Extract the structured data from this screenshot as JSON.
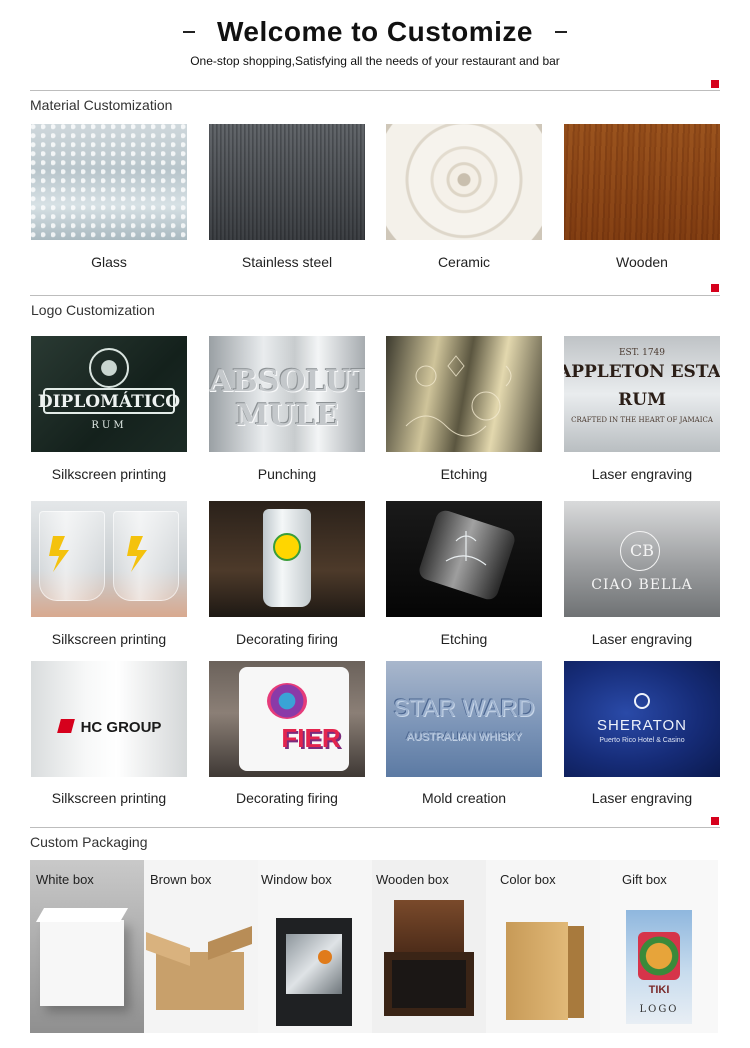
{
  "header": {
    "title": "Welcome to Customize",
    "subtitle": "One-stop shopping,Satisfying all the needs of your restaurant and bar"
  },
  "colors": {
    "accent": "#d6001c",
    "divider": "#bdbdbd"
  },
  "material": {
    "title": "Material Customization",
    "items": [
      {
        "label": "Glass",
        "icon": "glass-texture"
      },
      {
        "label": "Stainless steel",
        "icon": "steel-texture"
      },
      {
        "label": "Ceramic",
        "icon": "ceramic-texture"
      },
      {
        "label": "Wooden",
        "icon": "wood-texture"
      }
    ]
  },
  "logo": {
    "title": "Logo Customization",
    "rows": [
      [
        {
          "label": "Silkscreen printing",
          "img_text": [
            "DIPLOMÁTICO",
            "RUM"
          ]
        },
        {
          "label": "Punching",
          "img_text": [
            "ABSOLUT",
            "MULE"
          ]
        },
        {
          "label": "Etching",
          "img_text": []
        },
        {
          "label": "Laser engraving",
          "img_text": [
            "EST. 1749",
            "APPLETON ESTATE",
            "RUM",
            "CRAFTED IN THE HEART OF JAMAICA"
          ]
        }
      ],
      [
        {
          "label": "Silkscreen printing",
          "img_text": []
        },
        {
          "label": "Decorating firing",
          "img_text": []
        },
        {
          "label": "Etching",
          "img_text": []
        },
        {
          "label": "Laser engraving",
          "img_text": [
            "CB",
            "CIAO BELLA"
          ]
        }
      ],
      [
        {
          "label": "Silkscreen printing",
          "img_text": [
            "HC GROUP"
          ]
        },
        {
          "label": "Decorating firing",
          "img_text": [
            "FIER"
          ]
        },
        {
          "label": "Mold creation",
          "img_text": [
            "STAR WARD",
            "AUSTRALIAN WHISKY"
          ]
        },
        {
          "label": "Laser engraving",
          "img_text": [
            "SHERATON",
            "Puerto Rico Hotel & Casino"
          ]
        }
      ]
    ]
  },
  "packaging": {
    "title": "Custom Packaging",
    "items": [
      {
        "label": "White box"
      },
      {
        "label": "Brown box"
      },
      {
        "label": "Window box"
      },
      {
        "label": "Wooden box"
      },
      {
        "label": "Color box"
      },
      {
        "label": "Gift box",
        "img_text": [
          "TIKI",
          "LOGO"
        ]
      }
    ]
  }
}
